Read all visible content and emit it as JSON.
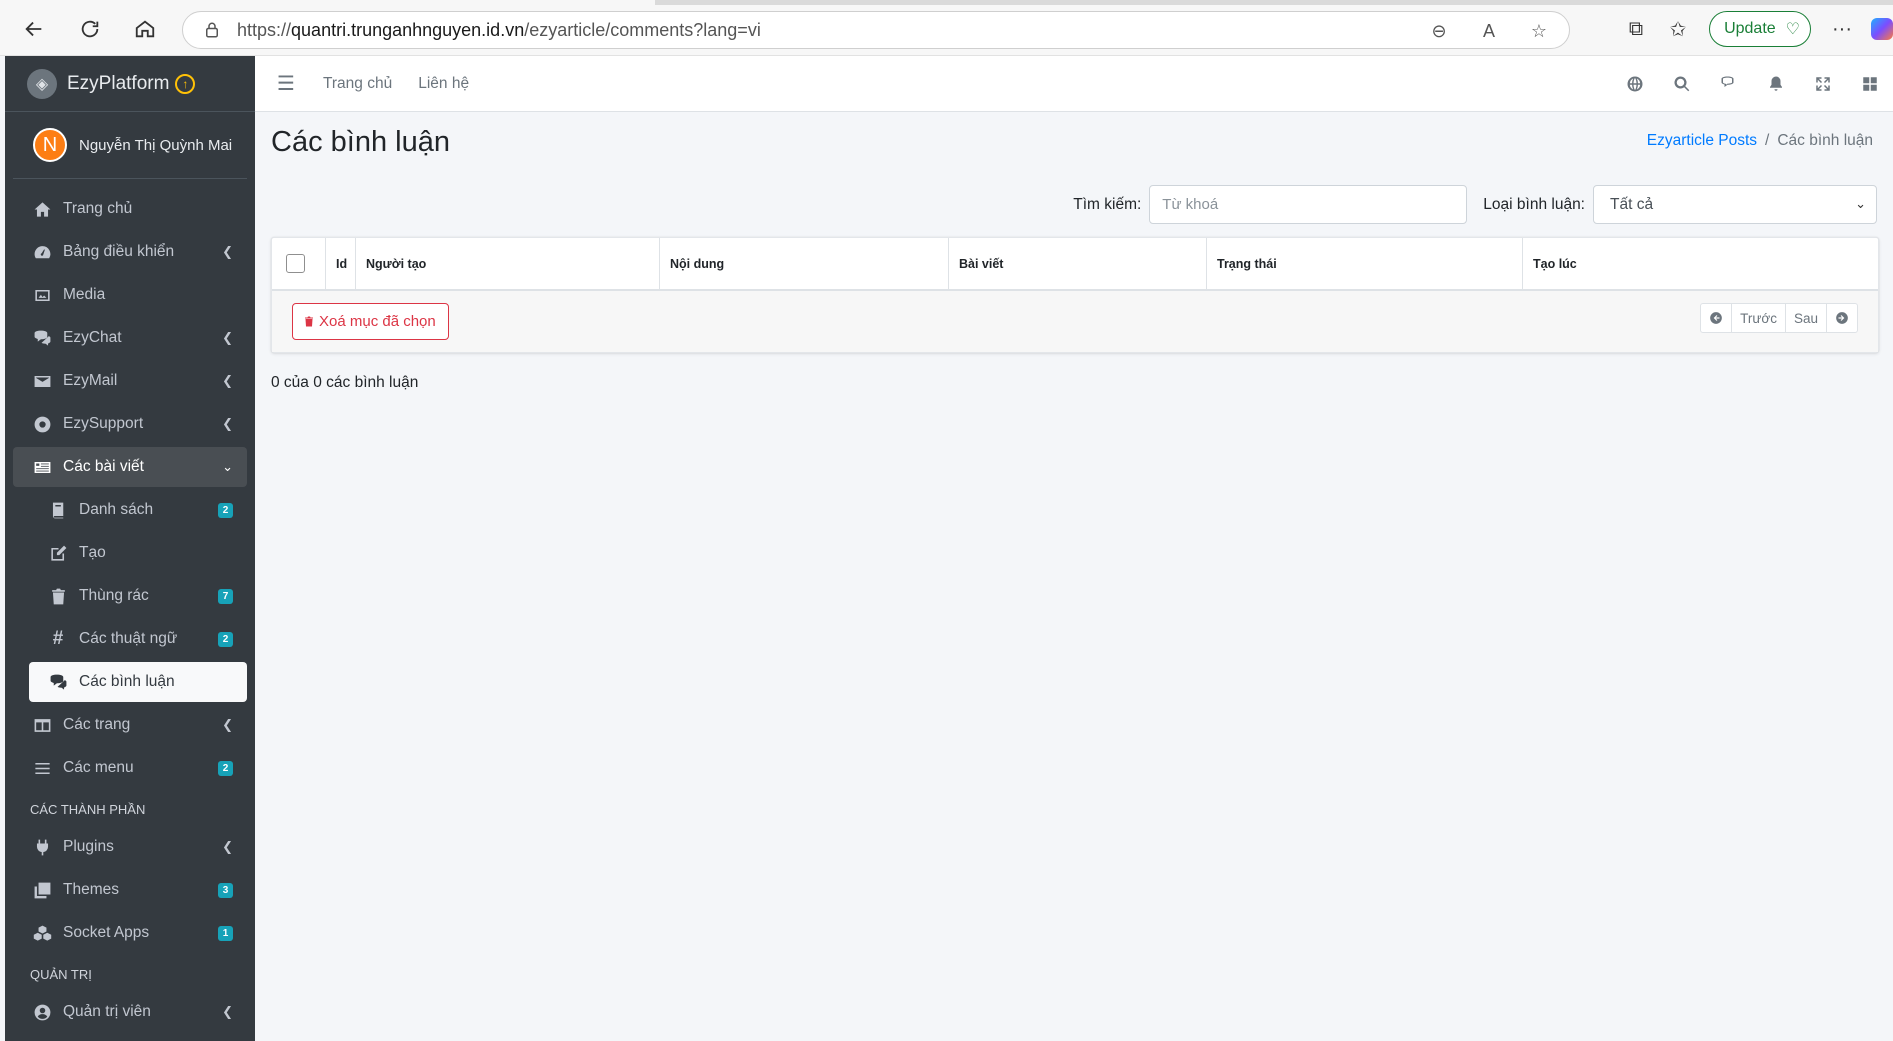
{
  "browser": {
    "url_prefix": "https://",
    "url_host": "quantri.trunganhnguyen.id.vn",
    "url_path": "/ezyarticle/comments?lang=vi",
    "update_label": "Update"
  },
  "sidebar": {
    "brand": "EzyPlatform",
    "user": {
      "initial": "N",
      "name": "Nguyễn Thị Quỳnh Mai"
    },
    "items": [
      {
        "label": "Trang chủ",
        "icon": "home-icon"
      },
      {
        "label": "Bảng điều khiển",
        "icon": "dashboard-icon"
      },
      {
        "label": "Media",
        "icon": "image-icon"
      },
      {
        "label": "EzyChat",
        "icon": "chat-icon"
      },
      {
        "label": "EzyMail",
        "icon": "mail-icon"
      },
      {
        "label": "EzySupport",
        "icon": "lifering-icon"
      },
      {
        "label": "Các bài viết",
        "icon": "article-icon"
      },
      {
        "label": "Danh sách",
        "icon": "book-icon",
        "badge": "2"
      },
      {
        "label": "Tạo",
        "icon": "edit-icon"
      },
      {
        "label": "Thùng rác",
        "icon": "trash-icon",
        "badge": "7"
      },
      {
        "label": "Các thuật ngữ",
        "icon": "hashtag-icon",
        "badge": "2"
      },
      {
        "label": "Các bình luận",
        "icon": "comments-icon"
      },
      {
        "label": "Các trang",
        "icon": "columns-icon"
      },
      {
        "label": "Các menu",
        "icon": "bars-icon",
        "badge": "2"
      },
      {
        "label": "Plugins",
        "icon": "plug-icon"
      },
      {
        "label": "Themes",
        "icon": "clone-icon",
        "badge": "3"
      },
      {
        "label": "Socket Apps",
        "icon": "cubes-icon",
        "badge": "1"
      },
      {
        "label": "Quản trị viên",
        "icon": "user-circle-icon"
      }
    ],
    "headers": {
      "components": "CÁC THÀNH PHẦN",
      "admin": "QUẢN TRỊ"
    }
  },
  "topnav": {
    "home": "Trang chủ",
    "contact": "Liên hệ"
  },
  "page": {
    "title": "Các bình luận",
    "breadcrumb": {
      "parent": "Ezyarticle Posts",
      "sep": "/",
      "current": "Các bình luận"
    },
    "search_label": "Tìm kiếm:",
    "search_placeholder": "Từ khoá",
    "type_label": "Loại bình luận:",
    "type_value": "Tất cả",
    "columns": [
      "Id",
      "Người tạo",
      "Nội dung",
      "Bài viết",
      "Trạng thái",
      "Tạo lúc"
    ],
    "delete_label": "Xoá mục đã chọn",
    "prev_label": "Trước",
    "next_label": "Sau",
    "count_text": "0 của 0 các bình luận"
  }
}
